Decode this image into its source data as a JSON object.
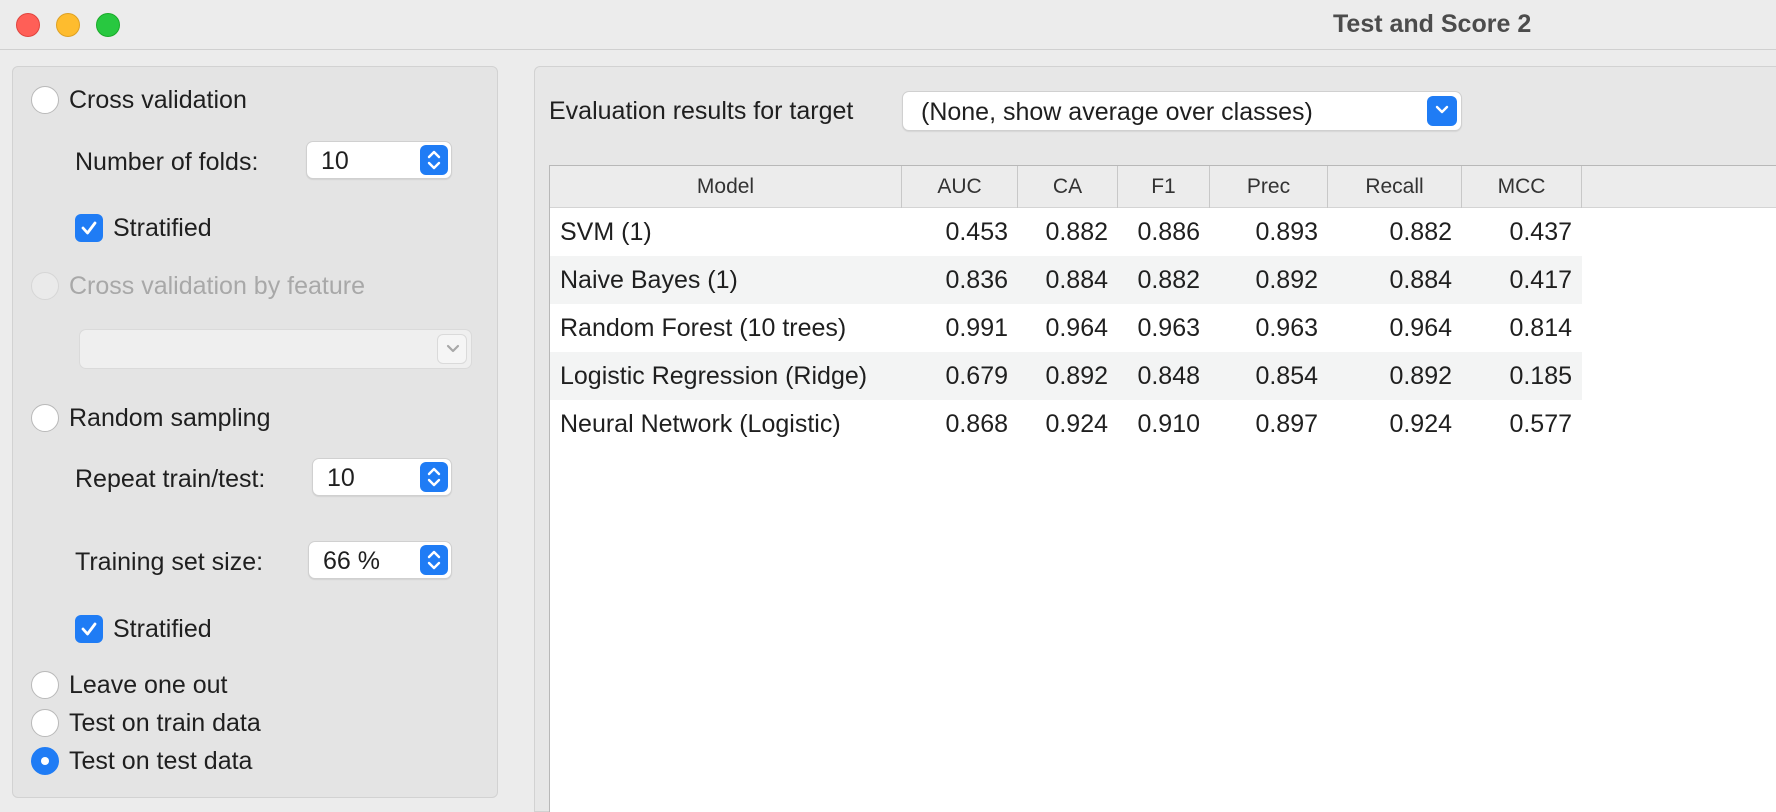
{
  "window": {
    "title": "Test and Score 2"
  },
  "sampling": {
    "cross_validation": {
      "label": "Cross validation",
      "checked": false
    },
    "folds": {
      "label": "Number of folds:",
      "value": "10"
    },
    "stratified_cv": {
      "label": "Stratified",
      "checked": true
    },
    "cv_by_feature": {
      "label": "Cross validation by feature",
      "enabled": false,
      "value": ""
    },
    "random_sampling": {
      "label": "Random sampling",
      "checked": false
    },
    "repeat": {
      "label": "Repeat train/test:",
      "value": "10"
    },
    "train_size": {
      "label": "Training set size:",
      "value": "66 %"
    },
    "stratified_rs": {
      "label": "Stratified",
      "checked": true
    },
    "leave_one_out": {
      "label": "Leave one out",
      "checked": false
    },
    "test_on_train": {
      "label": "Test on train data",
      "checked": false
    },
    "test_on_test": {
      "label": "Test on test data",
      "checked": true
    }
  },
  "target": {
    "label": "Evaluation results for target",
    "value": "(None, show average over classes)"
  },
  "table": {
    "columns": [
      "Model",
      "AUC",
      "CA",
      "F1",
      "Prec",
      "Recall",
      "MCC"
    ],
    "rows": [
      [
        "SVM (1)",
        "0.453",
        "0.882",
        "0.886",
        "0.893",
        "0.882",
        "0.437"
      ],
      [
        "Naive Bayes (1)",
        "0.836",
        "0.884",
        "0.882",
        "0.892",
        "0.884",
        "0.417"
      ],
      [
        "Random Forest (10 trees)",
        "0.991",
        "0.964",
        "0.963",
        "0.963",
        "0.964",
        "0.814"
      ],
      [
        "Logistic Regression (Ridge)",
        "0.679",
        "0.892",
        "0.848",
        "0.854",
        "0.892",
        "0.185"
      ],
      [
        "Neural Network (Logistic)",
        "0.868",
        "0.924",
        "0.910",
        "0.897",
        "0.924",
        "0.577"
      ]
    ]
  },
  "colors": {
    "accent": "#1f7cf5",
    "close": "#ff5f57",
    "minimize": "#febc2e",
    "maximize": "#28c840"
  }
}
